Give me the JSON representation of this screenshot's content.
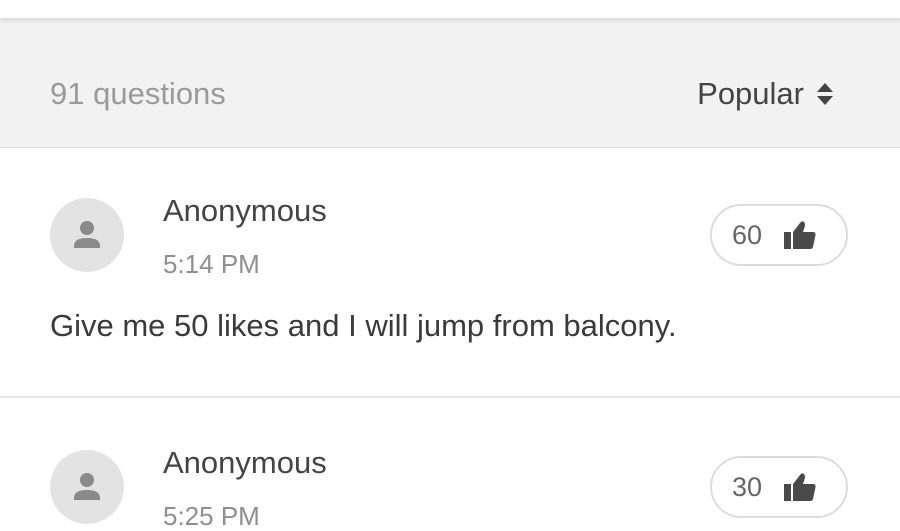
{
  "toolbar": {
    "count_label": "91 questions",
    "sort_label": "Popular",
    "sort_icon": "sort-arrows-icon"
  },
  "questions": [
    {
      "author": "Anonymous",
      "time": "5:14 PM",
      "likes": "60",
      "text": "Give me 50 likes and I will jump from balcony."
    },
    {
      "author": "Anonymous",
      "time": "5:25 PM",
      "likes": "30",
      "text": ""
    }
  ],
  "colors": {
    "toolbar_bg": "#f2f2f2",
    "avatar_bg": "#e3e3e3",
    "icon_gray": "#444444",
    "divider": "#e6e6e6"
  }
}
